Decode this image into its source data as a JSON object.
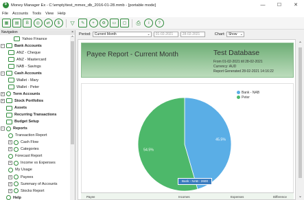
{
  "window": {
    "title": "Money Manager Ex - C:\\empty\\test_mmex_db_2016-01-28.mmb - [portable mode]",
    "controls": [
      "—",
      "☐",
      "✕"
    ]
  },
  "menu": [
    "File",
    "Accounts",
    "Tools",
    "View",
    "Help"
  ],
  "toolbar": {
    "icons": [
      "new-database-icon",
      "open-database-icon",
      "new-account-icon",
      "account-list-icon",
      "transaction-report-icon",
      "currency-icon",
      "filter-icon",
      "edit-icon",
      "add-icon",
      "settings-icon",
      "print-icon",
      "comment-icon",
      "print-icon",
      "about-icon",
      "help-icon"
    ]
  },
  "navigator": {
    "header": "Navigation",
    "close": "×",
    "items": [
      {
        "label": "Yahoo Finance",
        "level": 3
      },
      {
        "label": "Bank Accounts",
        "level": 1,
        "bold": true,
        "expander": "−"
      },
      {
        "label": "ANZ - Cheque",
        "level": 2
      },
      {
        "label": "ANZ - Mastercard",
        "level": 2
      },
      {
        "label": "NAB - Savings",
        "level": 2
      },
      {
        "label": "Cash Accounts",
        "level": 1,
        "bold": true,
        "expander": "−"
      },
      {
        "label": "Wallet - Mary",
        "level": 2
      },
      {
        "label": "Wallet - Peter",
        "level": 2
      },
      {
        "label": "Term Accounts",
        "level": 1,
        "bold": true,
        "expander": "+"
      },
      {
        "label": "Stock Portfolios",
        "level": 1,
        "bold": true,
        "expander": "+"
      },
      {
        "label": "Assets",
        "level": 1,
        "bold": true
      },
      {
        "label": "Recurring Transactions",
        "level": 1,
        "bold": true
      },
      {
        "label": "Budget Setup",
        "level": 1,
        "bold": true
      },
      {
        "label": "Reports",
        "level": 1,
        "bold": true,
        "expander": "−"
      },
      {
        "label": "Transaction Report",
        "level": 2
      },
      {
        "label": "Cash Flow",
        "level": 2,
        "expander": "+"
      },
      {
        "label": "Categories",
        "level": 2,
        "expander": "+"
      },
      {
        "label": "Forecast Report",
        "level": 2
      },
      {
        "label": "Income vs Expenses",
        "level": 2,
        "expander": "+"
      },
      {
        "label": "My Usage",
        "level": 2
      },
      {
        "label": "Payees",
        "level": 2,
        "expander": "+"
      },
      {
        "label": "Summary of Accounts",
        "level": 2,
        "expander": "+"
      },
      {
        "label": "Stocks Report",
        "level": 2,
        "expander": "+"
      },
      {
        "label": "Help",
        "level": 1,
        "bold": true
      }
    ]
  },
  "period": {
    "label": "Period:",
    "value": "Current Month",
    "from": "01-02-2021",
    "to": "28-02-2021",
    "chart_label": "Chart:",
    "chart_value": "Show"
  },
  "report": {
    "title": "Payee Report - Current Month",
    "database": "Test Database",
    "range": "From 01-02-2021 till 28-02-2021",
    "currency": "Currency: AUD",
    "generated": "Report Generated 28-02-2021 14:16:22",
    "tooltip": "Bank - NAB : 2600",
    "table_headers": [
      "Payee",
      "Incomes",
      "Expenses",
      "Difference"
    ]
  },
  "chart_data": {
    "type": "pie",
    "labels": [
      "Bank - NAB",
      "Peter"
    ],
    "values": [
      45.5,
      54.5
    ],
    "value_labels": [
      "45.5%",
      "54.5%"
    ],
    "colors": [
      "#5aaee6",
      "#4db86a"
    ],
    "legend_position": "top-right"
  }
}
